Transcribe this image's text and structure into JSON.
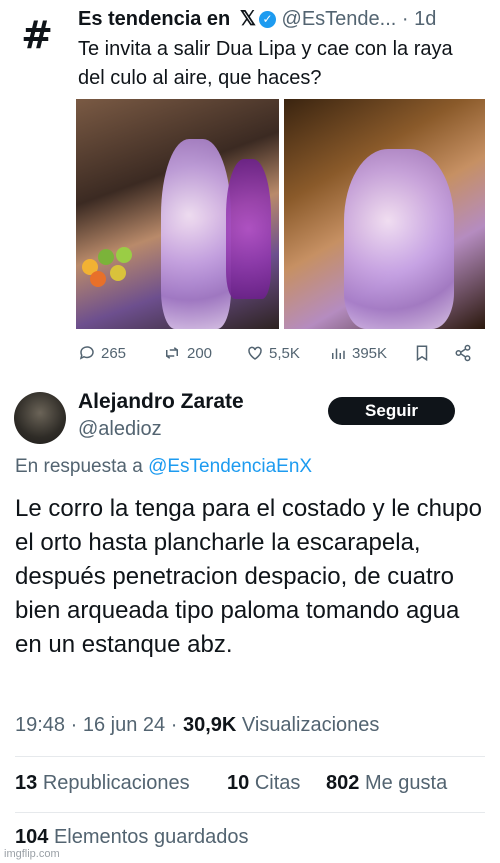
{
  "original_tweet": {
    "avatar_symbol": "#",
    "name": "Es tendencia en",
    "x_mark": "𝕏",
    "handle": "@EsTende...",
    "dot": "·",
    "time": "1d",
    "text": "Te invita a salir Dua Lipa y cae con la raya del culo al aire, que haces?",
    "actions": {
      "replies": "265",
      "reposts": "200",
      "likes": "5,5K",
      "views": "395K"
    }
  },
  "reply": {
    "name": "Alejandro Zarate",
    "handle": "@aledioz",
    "follow_label": "Seguir",
    "in_reply_prefix": "En respuesta a",
    "in_reply_mention": "@EsTendenciaEnX",
    "text": "Le corro la tenga para el costado y le chupo el orto hasta plancharle la escarapela, después penetracion despacio, de cuatro bien arqueada tipo paloma tomando agua en un estanque abz.",
    "time": "19:48",
    "date": "16 jun 24",
    "sep": "·",
    "views_count": "30,9K",
    "views_label": "Visualizaciones",
    "reposts_count": "13",
    "reposts_label": "Republicaciones",
    "quotes_count": "10",
    "quotes_label": "Citas",
    "likes_count": "802",
    "likes_label": "Me gusta",
    "bookmarks_count": "104",
    "bookmarks_label": "Elementos guardados"
  },
  "watermark": "imgflip.com",
  "colors": {
    "text": "#0f1419",
    "secondary": "#536471",
    "link": "#1d9bf0",
    "button": "#0f1419"
  }
}
